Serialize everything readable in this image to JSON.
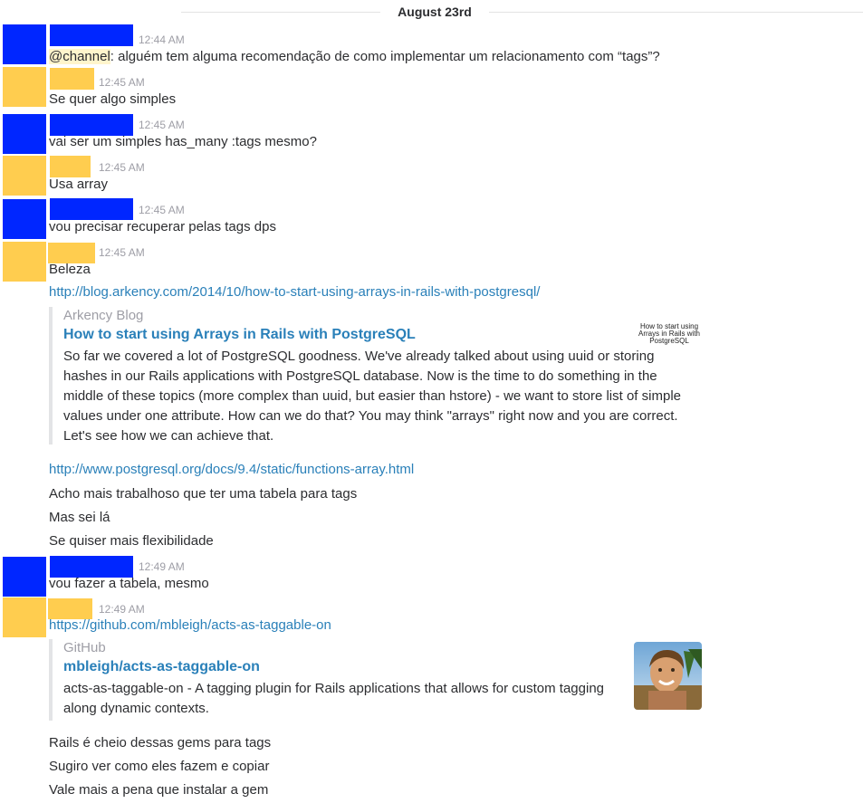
{
  "colors": {
    "blue_user": "#0026ff",
    "yellow_user": "#ffcd4f",
    "link": "#2a80b9",
    "mention_bg": "#fff5cc"
  },
  "date_divider": "August 23rd",
  "timestamps": {
    "t1": "12:44 AM",
    "t2": "12:45 AM",
    "t3": "12:45 AM",
    "t4": "12:45 AM",
    "t5": "12:45 AM",
    "t6": "12:45 AM",
    "t7": "12:49 AM",
    "t8": "12:49 AM"
  },
  "messages": {
    "m1_mention": "@channel",
    "m1_text": ": alguém tem alguma recomendação de como implementar um relacionamento com “tags”?",
    "m2": "Se quer algo simples",
    "m3": "vai ser um simples has_many :tags mesmo?",
    "m4": "Usa array",
    "m5": "vou precisar recuperar pelas tags dps",
    "m6": "Beleza",
    "m6_link": "http://blog.arkency.com/2014/10/how-to-start-using-arrays-in-rails-with-postgresql/",
    "m6_link2": "http://www.postgresql.org/docs/9.4/static/functions-array.html",
    "m6_b": "Acho mais trabalhoso que ter uma tabela para tags",
    "m6_c": "Mas sei lá",
    "m6_d": "Se quiser mais flexibilidade",
    "m7": "vou fazer a tabela, mesmo",
    "m8_link": "https://github.com/mbleigh/acts-as-taggable-on",
    "m8_b": "Rails é cheio dessas gems para tags",
    "m8_c": "Sugiro ver como eles fazem e copiar",
    "m8_d": "Vale mais a pena que instalar a gem"
  },
  "attachment1": {
    "source": "Arkency Blog",
    "title": "How to start using Arrays in Rails with PostgreSQL",
    "text": "So far we covered a lot of PostgreSQL goodness. We've already talked about using uuid or storing hashes in our Rails applications with PostgreSQL database. Now is the time to do something in the middle of these topics (more complex than uuid, but easier than hstore) - we want to store list of simple values under one attribute. How can we do that? You may think \"arrays\" right now and you are correct. Let's see how we can achieve that.",
    "thumb_text": "How to start using Arrays in Rails with PostgreSQL"
  },
  "attachment2": {
    "source": "GitHub",
    "title": "mbleigh/acts-as-taggable-on",
    "text": "acts-as-taggable-on - A tagging plugin for Rails applications that allows for custom tagging along dynamic contexts."
  }
}
